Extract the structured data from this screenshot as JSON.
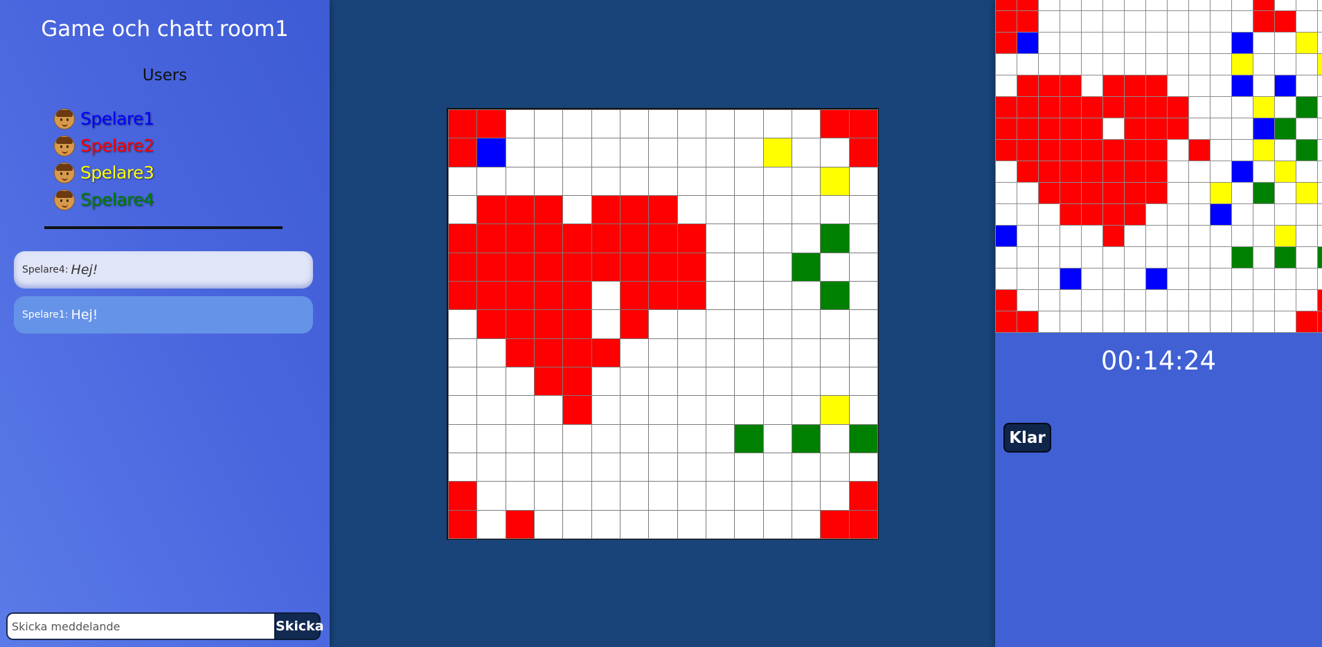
{
  "sidebar": {
    "room_title": "Game och chatt room1",
    "users_heading": "Users",
    "users": [
      {
        "name": "Spelare1",
        "color": "#0000ff"
      },
      {
        "name": "Spelare2",
        "color": "#ff0000"
      },
      {
        "name": "Spelare3",
        "color": "#ffff00"
      },
      {
        "name": "Spelare4",
        "color": "#008000"
      }
    ],
    "messages": [
      {
        "sender": "Spelare4:",
        "text": "Hej!"
      },
      {
        "sender": "Spelare1:",
        "text": "Hej!"
      }
    ],
    "input_placeholder": "Skicka meddelande",
    "send_label": "Skicka"
  },
  "board": {
    "colors": {
      "r": "#ff0000",
      "b": "#0000ff",
      "y": "#ffff00",
      "g": "#008000",
      ".": "#ffffff"
    },
    "rows": [
      "rr...........rr",
      "rb.........y..r",
      ".............y.",
      ".rrr.rrr.......",
      "rrrrrrrrr....g.",
      "rrrrrrrrr...g..",
      "rrrrr.rrr....g.",
      ".rrrr.r........",
      "..rrrr.........",
      "...rr..........",
      "....r........y.",
      "..........g.g.g",
      "...............",
      "r.............r",
      "r.r..........rr"
    ]
  },
  "mini_board": {
    "rows": [
      "rr..........r...",
      "rr..........rr..",
      "rb.........b..y.",
      "...........y...y",
      ".rrr.rrr...b.b..",
      "rrrrrrrrr...y.g.",
      "rrrrr.rrr...bg..",
      "rrrrrrrr.r..y.g.",
      ".rrrrrrr...b.y..",
      "..rrrrrr..y.g.y.",
      "...rrrr...b.....",
      "b....r.......y..",
      "...........g.g.g",
      "...b...b........",
      "r..............r",
      "rr............rr"
    ]
  },
  "status": {
    "timer": "00:14:24",
    "ready_label": "Klar"
  }
}
